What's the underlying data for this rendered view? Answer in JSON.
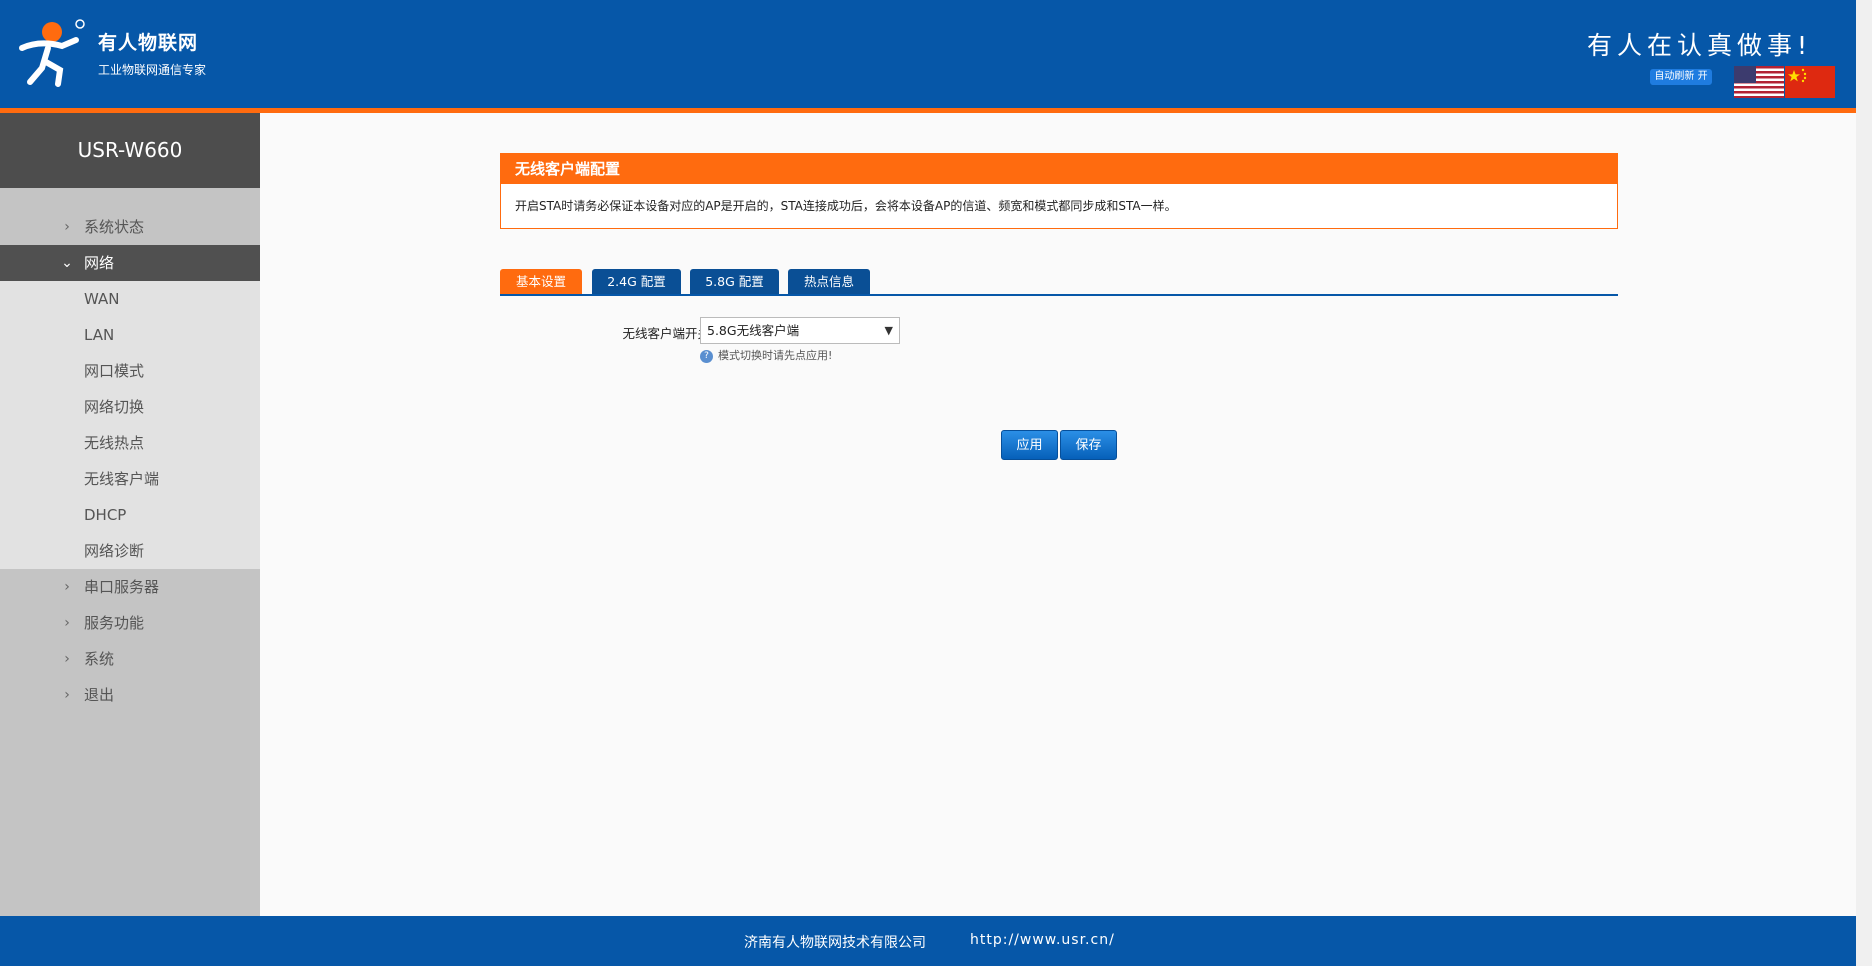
{
  "header": {
    "brand_name": "有人物联网",
    "brand_sub": "工业物联网通信专家",
    "slogan": "有人在认真做事!",
    "auto_refresh": "自动刷新 开",
    "colors": {
      "header_bg": "#0657a8",
      "accent": "#ff6b0f"
    }
  },
  "sidebar": {
    "device": "USR-W660",
    "items": [
      {
        "label": "系统状态",
        "icon": "chevron-right-icon"
      },
      {
        "label": "网络",
        "icon": "chevron-down-icon",
        "active": true
      },
      {
        "label": "串口服务器",
        "icon": "chevron-right-icon"
      },
      {
        "label": "服务功能",
        "icon": "chevron-right-icon"
      },
      {
        "label": "系统",
        "icon": "chevron-right-icon"
      },
      {
        "label": "退出",
        "icon": "chevron-right-icon"
      }
    ],
    "network_sub": [
      "WAN",
      "LAN",
      "网口模式",
      "网络切换",
      "无线热点",
      "无线客户端",
      "DHCP",
      "网络诊断"
    ]
  },
  "main": {
    "panel_title": "无线客户端配置",
    "panel_desc": "开启STA时请务必保证本设备对应的AP是开启的，STA连接成功后，会将本设备AP的信道、频宽和模式都同步成和STA一样。",
    "tabs": [
      "基本设置",
      "2.4G 配置",
      "5.8G 配置",
      "热点信息"
    ],
    "active_tab": "基本设置",
    "form": {
      "label": "无线客户端开关",
      "value": "5.8G无线客户端",
      "hint": "模式切换时请先点应用!"
    },
    "buttons": {
      "apply": "应用",
      "save": "保存"
    }
  },
  "footer": {
    "company": "济南有人物联网技术有限公司",
    "url": "http://www.usr.cn/"
  }
}
